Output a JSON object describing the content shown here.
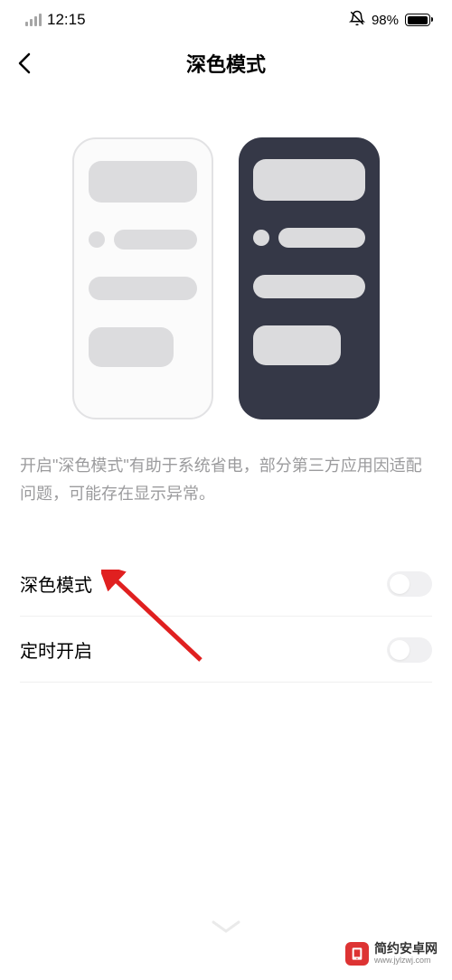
{
  "statusBar": {
    "time": "12:15",
    "batteryPct": "98%"
  },
  "header": {
    "title": "深色模式"
  },
  "description": "开启\"深色模式\"有助于系统省电，部分第三方应用因适配问题，可能存在显示异常。",
  "settings": {
    "darkMode": {
      "label": "深色模式",
      "enabled": false
    },
    "scheduled": {
      "label": "定时开启",
      "enabled": false
    }
  },
  "watermark": {
    "name": "简约安卓网",
    "url": "www.jylzwj.com"
  },
  "annotation": {
    "arrowColor": "#e02020"
  }
}
